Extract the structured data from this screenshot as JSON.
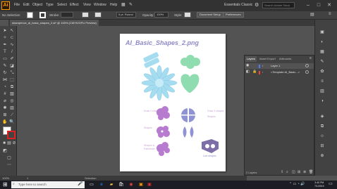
{
  "app": {
    "logo": "Ai",
    "menu": [
      "File",
      "Edit",
      "Object",
      "Type",
      "Select",
      "Effect",
      "View",
      "Window",
      "Help"
    ],
    "workspace": "Essentials Classic",
    "search_placeholder": "Search Adobe Stock"
  },
  "control_bar": {
    "selection_label": "No Selection",
    "stroke_label": "Stroke:",
    "brush_value": "5 pt. Round",
    "opacity_label": "Opacity:",
    "opacity_value": "100%",
    "style_label": "Style:",
    "document_setup": "Document Setup",
    "preferences": "Preferences"
  },
  "document": {
    "tab_title": "shamprince_ai_basic_shapes_2.ai* @ 100% (CMYK/GPU Preview)",
    "artboard_title": "AI_Basic_Shapes_2.png",
    "labels": [
      "Draw 2 shapes",
      "Draw 3 shapes",
      "Shapes & Pathfinder",
      "Live shapes",
      "Divide"
    ]
  },
  "status_bar": {
    "zoom": "100%",
    "page": "1",
    "tool": "Selection"
  },
  "layers_panel": {
    "tabs": [
      "Layers",
      "Asset Export",
      "Artboards"
    ],
    "layers": [
      {
        "name": "Layer 1",
        "color": "#4f7cff"
      },
      {
        "name": "<Template AI_Basic...>",
        "color": "#ff3b3b"
      }
    ],
    "footer": "2 Layers"
  },
  "taskbar": {
    "search_placeholder": "Type here to search",
    "time": "3:40 PM",
    "date": "7/1/2019"
  },
  "colors": {
    "accent": "#ff9a00",
    "title_purple": "#8f8ac8",
    "shape_blue": "#a6dcf0",
    "shape_green": "#8fdcb0",
    "shape_purple": "#b77bd0",
    "shape_indigo": "#8f93d4"
  }
}
